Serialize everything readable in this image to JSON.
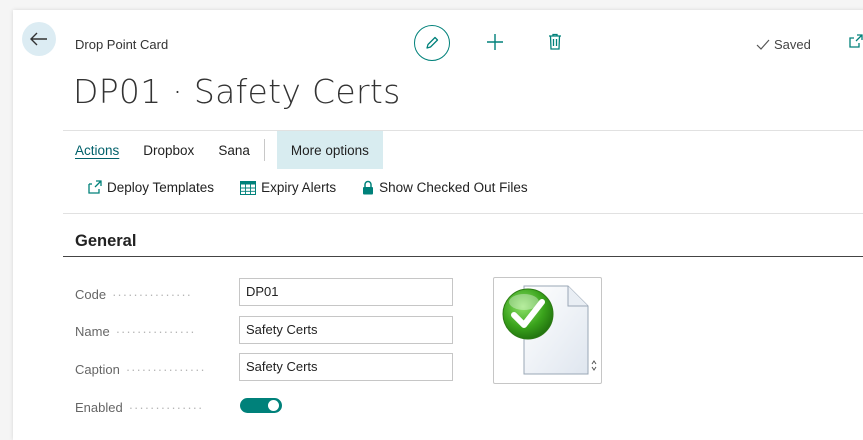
{
  "header": {
    "caption": "Drop Point Card",
    "title": "DP01 · Safety Certs",
    "saved_label": "Saved"
  },
  "menu": {
    "items": [
      "Actions",
      "Dropbox",
      "Sana"
    ],
    "more_options": "More options"
  },
  "actions": [
    {
      "label": "Deploy Templates",
      "icon": "deploy-icon"
    },
    {
      "label": "Expiry Alerts",
      "icon": "table-icon"
    },
    {
      "label": "Show Checked Out Files",
      "icon": "lock-icon"
    }
  ],
  "general": {
    "title": "General",
    "fields": [
      {
        "label": "Code",
        "value": "DP01"
      },
      {
        "label": "Name",
        "value": "Safety Certs"
      },
      {
        "label": "Caption",
        "value": "Safety Certs"
      },
      {
        "label": "Enabled",
        "value": "On"
      }
    ]
  },
  "colors": {
    "accent": "#00817a",
    "link": "#00606a",
    "more_bg": "#d8ecf0"
  }
}
